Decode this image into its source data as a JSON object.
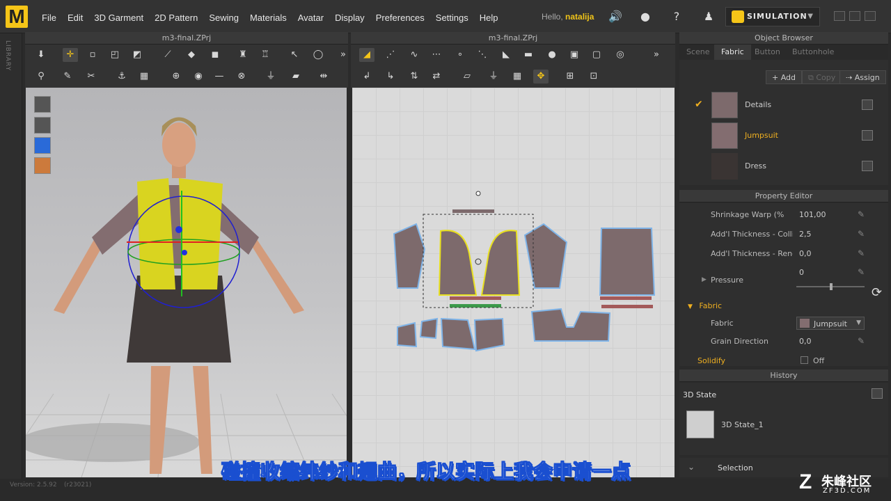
{
  "app": {
    "logo_letter": "M",
    "menu": [
      "File",
      "Edit",
      "3D Garment",
      "2D Pattern",
      "Sewing",
      "Materials",
      "Avatar",
      "Display",
      "Preferences",
      "Settings",
      "Help"
    ],
    "hello_prefix": "Hello,",
    "user": "natalija",
    "simulation_label": "SIMULATION"
  },
  "library_label": "LIBRARY",
  "view3d": {
    "title": "m3-final.ZPrj"
  },
  "view2d": {
    "title": "m3-final.ZPrj"
  },
  "object_browser": {
    "title": "Object Browser",
    "tabs": [
      "Scene",
      "Fabric",
      "Button",
      "Buttonhole"
    ],
    "selected_tab": "Fabric",
    "add_label": "Add",
    "copy_label": "Copy",
    "assign_label": "Assign",
    "fabrics": [
      {
        "name": "Details",
        "color": "#7d6a6c",
        "checked": true
      },
      {
        "name": "Jumpsuit",
        "color": "#836d70",
        "checked": false
      },
      {
        "name": "Dress",
        "color": "#3a3433",
        "checked": false
      }
    ]
  },
  "property_editor": {
    "title": "Property Editor",
    "rows": [
      {
        "label": "Shrinkage Warp (%",
        "value": "101,00"
      },
      {
        "label": "Add'l Thickness - Collision",
        "value": "2,5"
      },
      {
        "label": "Add'l Thickness - Rendering",
        "value": "0,0"
      }
    ],
    "pressure_label": "Pressure",
    "pressure_value": "0",
    "fabric_section": "Fabric",
    "fabric_label": "Fabric",
    "fabric_value": "Jumpsuit",
    "grain_label": "Grain Direction",
    "grain_value": "0,0",
    "solidify_label": "Solidify",
    "solidify_value": "Off"
  },
  "history": {
    "title": "History",
    "state_header": "3D State",
    "state_item": "3D State_1",
    "selection_label": "Selection"
  },
  "status": {
    "version": "Version: 2.5.92",
    "build": "(r23021)"
  },
  "subtitle": "碰撞收缩纬纱和翘曲，所以实际上我会申请一点",
  "watermark": {
    "brand": "朱峰社区",
    "site": "ZF3D.COM"
  },
  "colors": {
    "accent": "#f5c518",
    "highlight": "#f0b020",
    "pattern": "#7d6a6c",
    "pattern_selected": "#e8e020"
  }
}
